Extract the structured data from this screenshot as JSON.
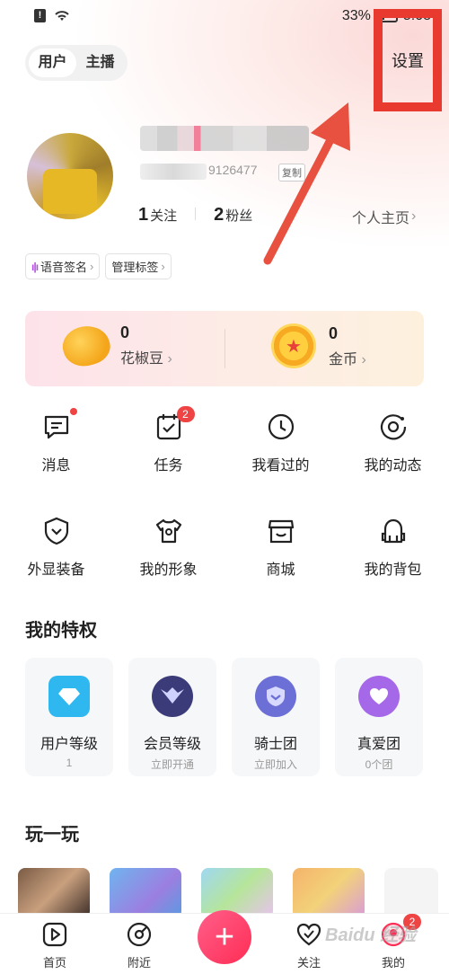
{
  "status_bar": {
    "battery": "33%",
    "time": "5:08"
  },
  "role_tabs": [
    "用户",
    "主播"
  ],
  "header": {
    "settings_label": "设置"
  },
  "profile": {
    "uid_suffix": "9126477",
    "copy_label": "复制",
    "following_count": "1",
    "following_label": "关注",
    "followers_count": "2",
    "followers_label": "粉丝",
    "homepage_label": "个人主页"
  },
  "tags": [
    "语音签名",
    "管理标签"
  ],
  "wallet": {
    "beans_value": "0",
    "beans_label": "花椒豆",
    "coins_value": "0",
    "coins_label": "金币"
  },
  "grid": [
    {
      "label": "消息",
      "icon": "message-icon"
    },
    {
      "label": "任务",
      "icon": "task-icon",
      "badge": "2"
    },
    {
      "label": "我看过的",
      "icon": "clock-icon"
    },
    {
      "label": "我的动态",
      "icon": "moments-icon"
    },
    {
      "label": "外显装备",
      "icon": "shield-icon"
    },
    {
      "label": "我的形象",
      "icon": "tshirt-icon"
    },
    {
      "label": "商城",
      "icon": "store-icon"
    },
    {
      "label": "我的背包",
      "icon": "backpack-icon"
    }
  ],
  "privileges": {
    "title": "我的特权",
    "items": [
      {
        "name": "用户等级",
        "sub": "1",
        "icon": "diamond-icon",
        "color": "#2fb8f0"
      },
      {
        "name": "会员等级",
        "sub": "立即开通",
        "icon": "vip-wings-icon",
        "color": "#3b3b7a"
      },
      {
        "name": "骑士团",
        "sub": "立即加入",
        "icon": "knight-shield-icon",
        "color": "#6c6fd6"
      },
      {
        "name": "真爱团",
        "sub": "0个团",
        "icon": "heart-hands-icon",
        "color": "#a468e8"
      }
    ]
  },
  "play": {
    "title": "玩一玩"
  },
  "bottom_nav": {
    "home": "首页",
    "nearby": "附近",
    "follow": "关注",
    "mine": "我的",
    "mine_badge": "2"
  },
  "watermark": "Baidu 经验"
}
